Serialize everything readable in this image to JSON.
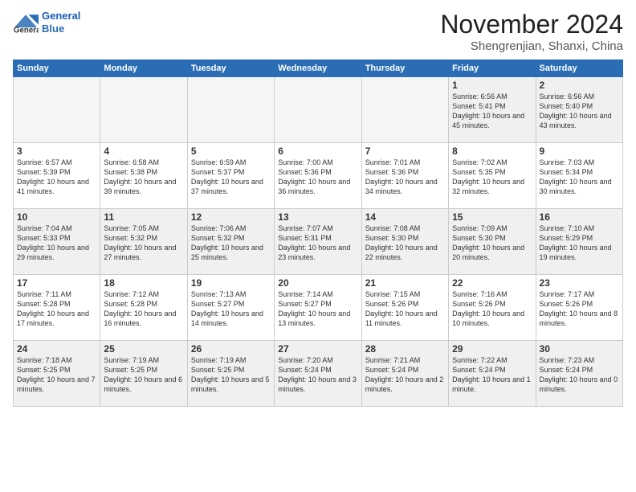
{
  "header": {
    "logo_line1": "General",
    "logo_line2": "Blue",
    "month": "November 2024",
    "location": "Shengrenjian, Shanxi, China"
  },
  "weekdays": [
    "Sunday",
    "Monday",
    "Tuesday",
    "Wednesday",
    "Thursday",
    "Friday",
    "Saturday"
  ],
  "weeks": [
    [
      {
        "day": "",
        "info": ""
      },
      {
        "day": "",
        "info": ""
      },
      {
        "day": "",
        "info": ""
      },
      {
        "day": "",
        "info": ""
      },
      {
        "day": "",
        "info": ""
      },
      {
        "day": "1",
        "info": "Sunrise: 6:56 AM\nSunset: 5:41 PM\nDaylight: 10 hours\nand 45 minutes."
      },
      {
        "day": "2",
        "info": "Sunrise: 6:56 AM\nSunset: 5:40 PM\nDaylight: 10 hours\nand 43 minutes."
      }
    ],
    [
      {
        "day": "3",
        "info": "Sunrise: 6:57 AM\nSunset: 5:39 PM\nDaylight: 10 hours\nand 41 minutes."
      },
      {
        "day": "4",
        "info": "Sunrise: 6:58 AM\nSunset: 5:38 PM\nDaylight: 10 hours\nand 39 minutes."
      },
      {
        "day": "5",
        "info": "Sunrise: 6:59 AM\nSunset: 5:37 PM\nDaylight: 10 hours\nand 37 minutes."
      },
      {
        "day": "6",
        "info": "Sunrise: 7:00 AM\nSunset: 5:36 PM\nDaylight: 10 hours\nand 36 minutes."
      },
      {
        "day": "7",
        "info": "Sunrise: 7:01 AM\nSunset: 5:36 PM\nDaylight: 10 hours\nand 34 minutes."
      },
      {
        "day": "8",
        "info": "Sunrise: 7:02 AM\nSunset: 5:35 PM\nDaylight: 10 hours\nand 32 minutes."
      },
      {
        "day": "9",
        "info": "Sunrise: 7:03 AM\nSunset: 5:34 PM\nDaylight: 10 hours\nand 30 minutes."
      }
    ],
    [
      {
        "day": "10",
        "info": "Sunrise: 7:04 AM\nSunset: 5:33 PM\nDaylight: 10 hours\nand 29 minutes."
      },
      {
        "day": "11",
        "info": "Sunrise: 7:05 AM\nSunset: 5:32 PM\nDaylight: 10 hours\nand 27 minutes."
      },
      {
        "day": "12",
        "info": "Sunrise: 7:06 AM\nSunset: 5:32 PM\nDaylight: 10 hours\nand 25 minutes."
      },
      {
        "day": "13",
        "info": "Sunrise: 7:07 AM\nSunset: 5:31 PM\nDaylight: 10 hours\nand 23 minutes."
      },
      {
        "day": "14",
        "info": "Sunrise: 7:08 AM\nSunset: 5:30 PM\nDaylight: 10 hours\nand 22 minutes."
      },
      {
        "day": "15",
        "info": "Sunrise: 7:09 AM\nSunset: 5:30 PM\nDaylight: 10 hours\nand 20 minutes."
      },
      {
        "day": "16",
        "info": "Sunrise: 7:10 AM\nSunset: 5:29 PM\nDaylight: 10 hours\nand 19 minutes."
      }
    ],
    [
      {
        "day": "17",
        "info": "Sunrise: 7:11 AM\nSunset: 5:28 PM\nDaylight: 10 hours\nand 17 minutes."
      },
      {
        "day": "18",
        "info": "Sunrise: 7:12 AM\nSunset: 5:28 PM\nDaylight: 10 hours\nand 16 minutes."
      },
      {
        "day": "19",
        "info": "Sunrise: 7:13 AM\nSunset: 5:27 PM\nDaylight: 10 hours\nand 14 minutes."
      },
      {
        "day": "20",
        "info": "Sunrise: 7:14 AM\nSunset: 5:27 PM\nDaylight: 10 hours\nand 13 minutes."
      },
      {
        "day": "21",
        "info": "Sunrise: 7:15 AM\nSunset: 5:26 PM\nDaylight: 10 hours\nand 11 minutes."
      },
      {
        "day": "22",
        "info": "Sunrise: 7:16 AM\nSunset: 5:26 PM\nDaylight: 10 hours\nand 10 minutes."
      },
      {
        "day": "23",
        "info": "Sunrise: 7:17 AM\nSunset: 5:26 PM\nDaylight: 10 hours\nand 8 minutes."
      }
    ],
    [
      {
        "day": "24",
        "info": "Sunrise: 7:18 AM\nSunset: 5:25 PM\nDaylight: 10 hours\nand 7 minutes."
      },
      {
        "day": "25",
        "info": "Sunrise: 7:19 AM\nSunset: 5:25 PM\nDaylight: 10 hours\nand 6 minutes."
      },
      {
        "day": "26",
        "info": "Sunrise: 7:19 AM\nSunset: 5:25 PM\nDaylight: 10 hours\nand 5 minutes."
      },
      {
        "day": "27",
        "info": "Sunrise: 7:20 AM\nSunset: 5:24 PM\nDaylight: 10 hours\nand 3 minutes."
      },
      {
        "day": "28",
        "info": "Sunrise: 7:21 AM\nSunset: 5:24 PM\nDaylight: 10 hours\nand 2 minutes."
      },
      {
        "day": "29",
        "info": "Sunrise: 7:22 AM\nSunset: 5:24 PM\nDaylight: 10 hours\nand 1 minute."
      },
      {
        "day": "30",
        "info": "Sunrise: 7:23 AM\nSunset: 5:24 PM\nDaylight: 10 hours\nand 0 minutes."
      }
    ]
  ]
}
